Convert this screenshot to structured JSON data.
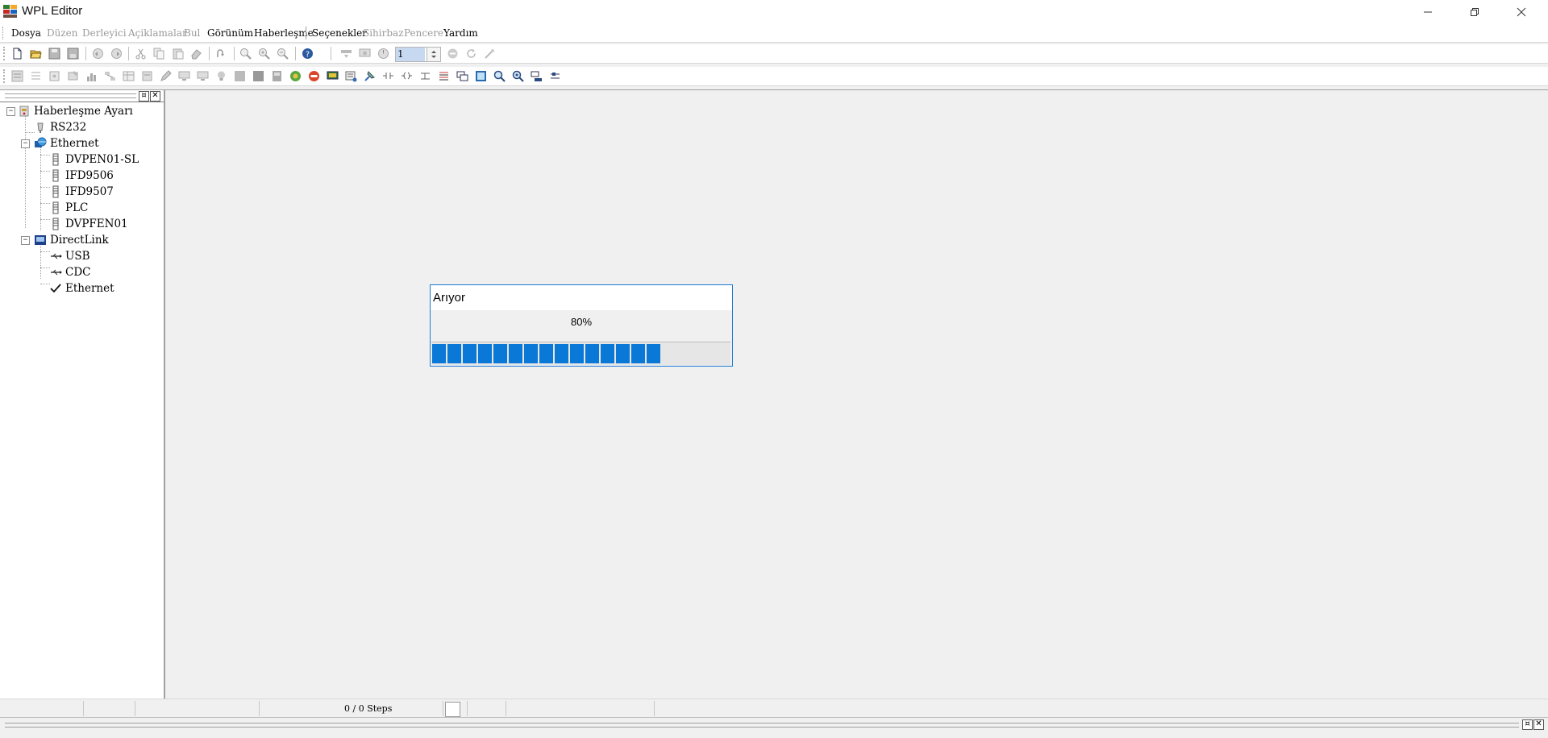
{
  "window": {
    "title": "WPL Editor"
  },
  "menu": {
    "items": [
      {
        "label": "Dosya",
        "enabled": true
      },
      {
        "label": "Düzen",
        "enabled": false
      },
      {
        "label": "Derleyici",
        "enabled": false
      },
      {
        "label": "Açiklamalar",
        "enabled": false
      },
      {
        "label": "Bul",
        "enabled": false
      },
      {
        "label": "Görünüm",
        "enabled": true
      },
      {
        "label": "Haberleşme",
        "enabled": true
      },
      {
        "label": "Seçenekler",
        "enabled": true
      },
      {
        "label": "Sihirbaz",
        "enabled": false
      },
      {
        "label": "Pencere",
        "enabled": false
      },
      {
        "label": "Yardım",
        "enabled": true
      }
    ]
  },
  "toolbar": {
    "step_value": "1"
  },
  "tree": {
    "root": "Haberleşme Ayarı",
    "rs232": "RS232",
    "ethernet": "Ethernet",
    "ethernet_children": [
      "DVPEN01-SL",
      "IFD9506",
      "IFD9507",
      "PLC",
      "DVPFEN01"
    ],
    "directlink": "DirectLink",
    "directlink_children": [
      "USB",
      "CDC",
      "Ethernet"
    ]
  },
  "dialog": {
    "title": "Arıyor",
    "percent_text": "80%",
    "progress": 0.8,
    "accent": "#0a78d7"
  },
  "statusbar": {
    "steps": "0 / 0 Steps"
  }
}
